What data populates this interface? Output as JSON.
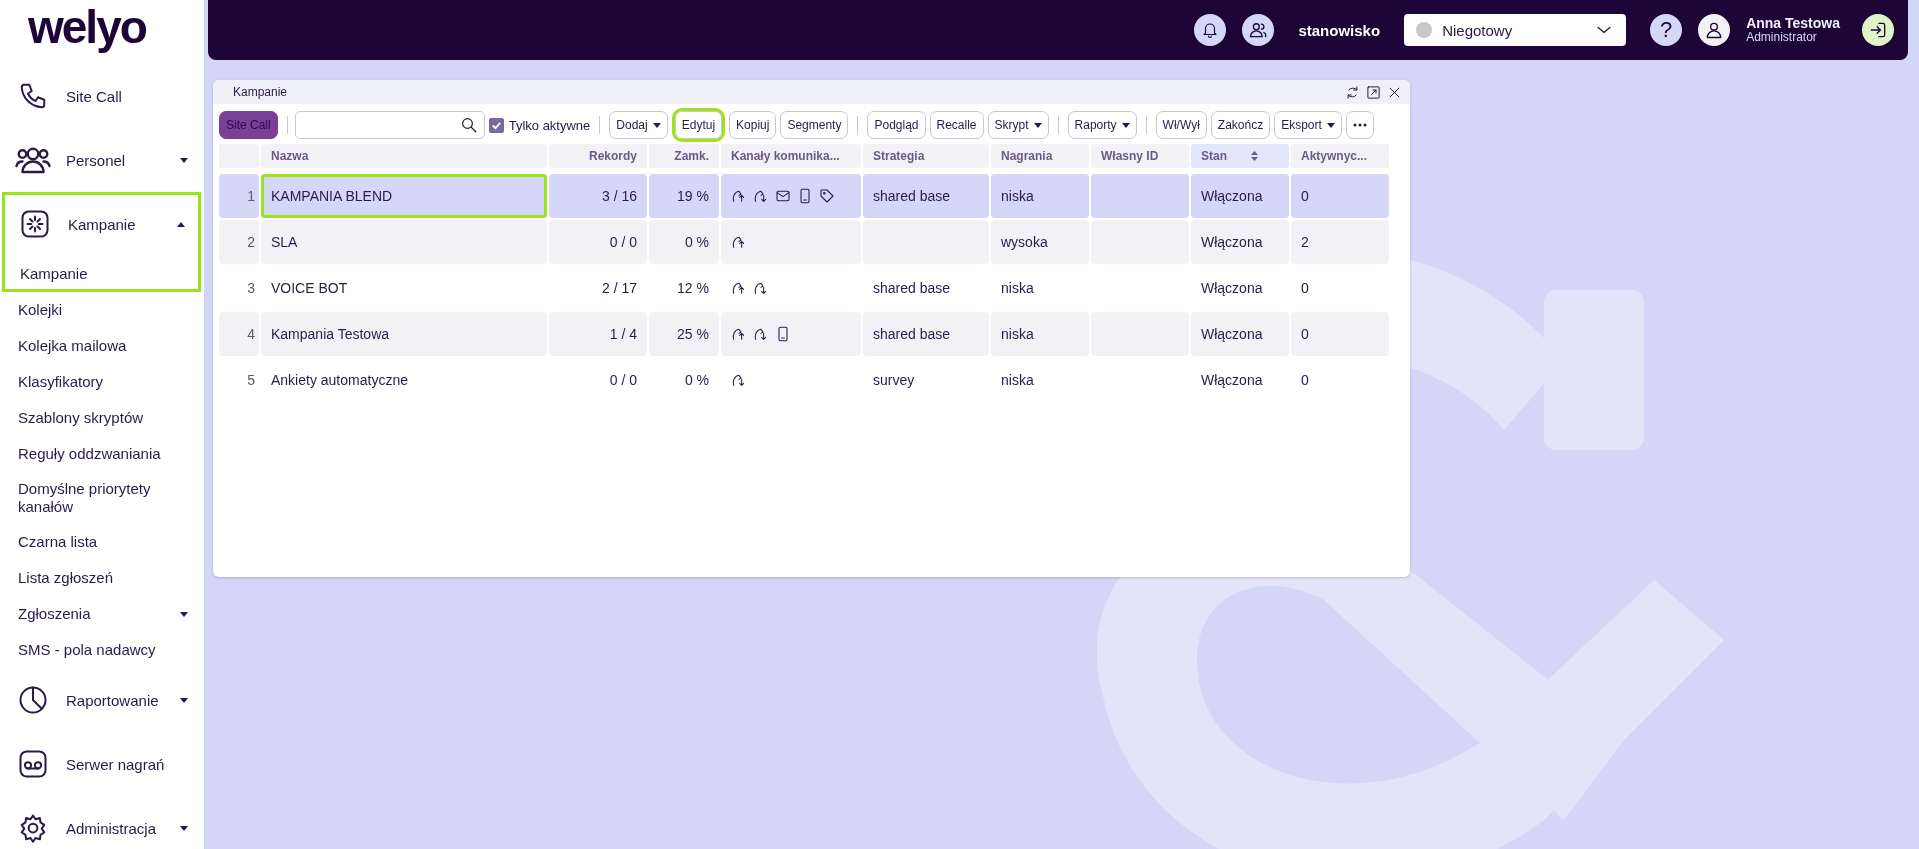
{
  "sidebar": {
    "logo": "welyo",
    "nav": [
      {
        "kind": "section",
        "label": "Site Call"
      },
      {
        "kind": "section",
        "label": "Personel",
        "expanded": false
      },
      {
        "kind": "section",
        "label": "Kampanie",
        "expanded": true,
        "highlighted": true,
        "children": [
          {
            "label": "Kampanie",
            "highlighted": true
          },
          {
            "label": "Kolejki",
            "highlighted": false
          },
          {
            "label": "Kolejka mailowa",
            "highlighted": false
          },
          {
            "label": "Klasyfikatory",
            "highlighted": false
          },
          {
            "label": "Szablony skryptów",
            "highlighted": false
          },
          {
            "label": "Reguły oddzwaniania",
            "highlighted": false
          },
          {
            "label": "Domyślne priorytety kanałów",
            "highlighted": false
          },
          {
            "label": "Czarna lista",
            "highlighted": false
          },
          {
            "label": "Lista zgłoszeń",
            "highlighted": false
          },
          {
            "label": "Zgłoszenia",
            "expanded": false,
            "highlighted": false
          },
          {
            "label": "SMS - pola nadawcy",
            "highlighted": false
          }
        ]
      },
      {
        "kind": "section",
        "label": "Raportowanie",
        "expanded": false
      },
      {
        "kind": "section",
        "label": "Serwer nagrań"
      },
      {
        "kind": "section",
        "label": "Administracja",
        "expanded": false
      }
    ]
  },
  "topbar": {
    "workstation": "stanowisko",
    "status": {
      "value": "Niegotowy",
      "color": "#c8c8c8"
    },
    "help": "?",
    "user": {
      "name": "Anna Testowa",
      "role": "Administrator"
    }
  },
  "panel": {
    "title": "Kampanie",
    "toolbar": [
      {
        "kind": "button",
        "label": "Site Call",
        "primary": true
      },
      {
        "kind": "separator"
      },
      {
        "kind": "search"
      },
      {
        "kind": "checkbox",
        "label": "Tylko aktywne",
        "checked": true
      },
      {
        "kind": "separator"
      },
      {
        "kind": "button",
        "label": "Dodaj",
        "dropdown": true
      },
      {
        "kind": "button",
        "label": "Edytuj",
        "highlighted": true
      },
      {
        "kind": "button",
        "label": "Kopiuj"
      },
      {
        "kind": "button",
        "label": "Segmenty"
      },
      {
        "kind": "separator"
      },
      {
        "kind": "button",
        "label": "Podgląd"
      },
      {
        "kind": "button",
        "label": "Recalle"
      },
      {
        "kind": "button",
        "label": "Skrypt",
        "dropdown": true
      },
      {
        "kind": "separator"
      },
      {
        "kind": "button",
        "label": "Raporty",
        "dropdown": true
      },
      {
        "kind": "separator"
      },
      {
        "kind": "button",
        "label": "Wł/Wył"
      },
      {
        "kind": "button",
        "label": "Zakończ"
      },
      {
        "kind": "button",
        "label": "Eksport",
        "dropdown": true
      },
      {
        "kind": "more"
      }
    ],
    "table": {
      "columns": [
        {
          "label": "Nazwa",
          "sortable": false
        },
        {
          "label": "Rekordy",
          "sortable": false
        },
        {
          "label": "Zamk.",
          "sortable": false
        },
        {
          "label": "Kanały komunika...",
          "sortable": false
        },
        {
          "label": "Strategia",
          "sortable": false
        },
        {
          "label": "Nagrania",
          "sortable": false
        },
        {
          "label": "Własny ID",
          "sortable": false
        },
        {
          "label": "Stan",
          "sortable": true
        },
        {
          "label": "Aktywnyc...",
          "sortable": false
        }
      ],
      "rows": [
        {
          "index": "1",
          "name": "KAMPANIA BLEND",
          "records": "3 / 16",
          "closed": "19 %",
          "channels": [
            {
              "kind": "outbound"
            },
            {
              "kind": "inbound"
            },
            {
              "kind": "email"
            },
            {
              "kind": "mobile"
            },
            {
              "kind": "tag"
            }
          ],
          "strategy": "shared base",
          "recordings": "niska",
          "state": "Włączona",
          "active": "0",
          "selected": true,
          "highlighted": true
        },
        {
          "index": "2",
          "name": "SLA",
          "records": "0 / 0",
          "closed": "0 %",
          "channels": [
            {
              "kind": "outbound"
            }
          ],
          "recordings": "wysoka",
          "state": "Włączona",
          "active": "2",
          "selected": false,
          "highlighted": false
        },
        {
          "index": "3",
          "name": "VOICE BOT",
          "records": "2 / 17",
          "closed": "12 %",
          "channels": [
            {
              "kind": "outbound"
            },
            {
              "kind": "inbound"
            }
          ],
          "strategy": "shared base",
          "recordings": "niska",
          "state": "Włączona",
          "active": "0",
          "selected": false,
          "highlighted": false
        },
        {
          "index": "4",
          "name": "Kampania Testowa",
          "records": "1 / 4",
          "closed": "25 %",
          "channels": [
            {
              "kind": "outbound"
            },
            {
              "kind": "inbound"
            },
            {
              "kind": "mobile"
            }
          ],
          "strategy": "shared base",
          "recordings": "niska",
          "state": "Włączona",
          "active": "0",
          "selected": false,
          "highlighted": false
        },
        {
          "index": "5",
          "name": "Ankiety automatyczne",
          "records": "0 / 0",
          "closed": "0 %",
          "channels": [
            {
              "kind": "inbound"
            }
          ],
          "strategy": "survey",
          "recordings": "niska",
          "state": "Włączona",
          "active": "0",
          "selected": false,
          "highlighted": false
        }
      ]
    }
  }
}
